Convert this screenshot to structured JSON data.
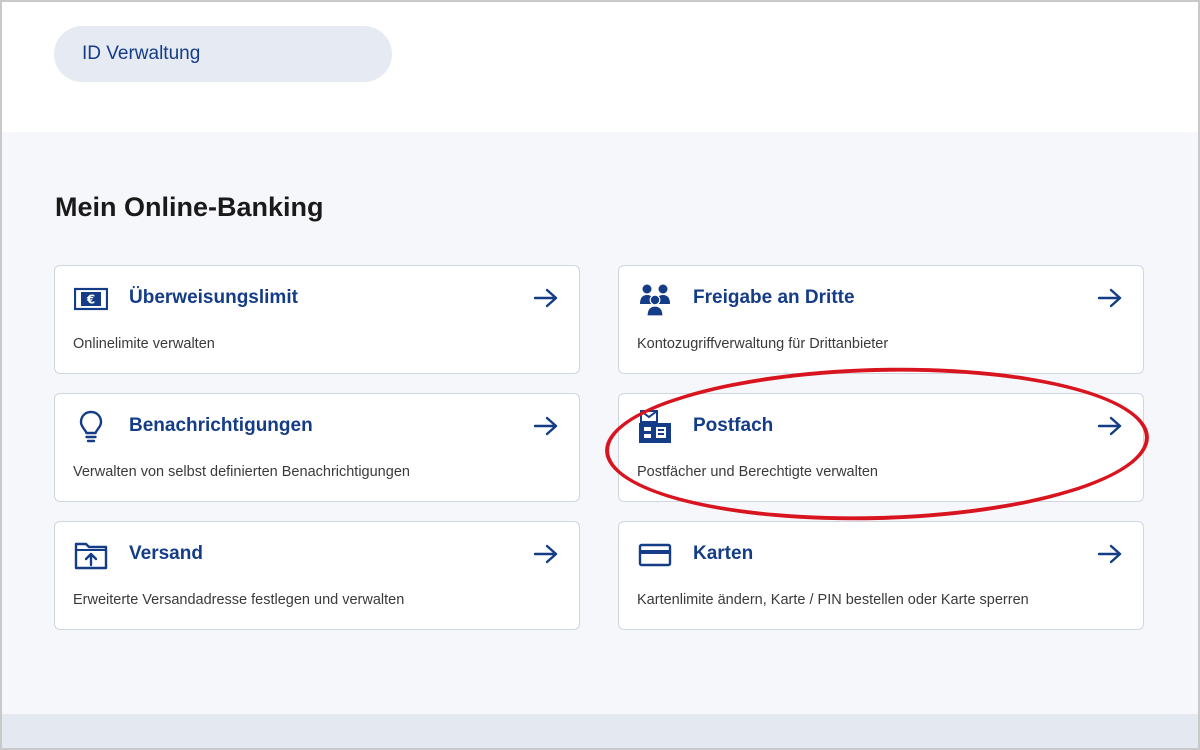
{
  "header": {
    "id_management_label": "ID Verwaltung"
  },
  "main": {
    "title": "Mein Online-Banking",
    "cards": [
      {
        "title": "Überweisungslimit",
        "description": "Onlinelimite verwalten",
        "icon": "euro-note-icon"
      },
      {
        "title": "Freigabe an Dritte",
        "description": "Kontozugriffverwaltung für Drittanbieter",
        "icon": "people-group-icon"
      },
      {
        "title": "Benachrichtigungen",
        "description": "Verwalten von selbst definierten Benachrichtigungen",
        "icon": "lightbulb-icon"
      },
      {
        "title": "Postfach",
        "description": "Postfächer und Berechtigte verwalten",
        "icon": "mailbox-icon"
      },
      {
        "title": "Versand",
        "description": "Erweiterte Versandadresse festlegen und verwalten",
        "icon": "folder-upload-icon"
      },
      {
        "title": "Karten",
        "description": "Kartenlimite ändern, Karte / PIN bestellen oder Karte sperren",
        "icon": "card-icon"
      }
    ]
  },
  "colors": {
    "primary": "#143c87",
    "pill_background": "#e6ebf3",
    "page_background": "#f6f7fa",
    "annotation": "#d8151f"
  }
}
